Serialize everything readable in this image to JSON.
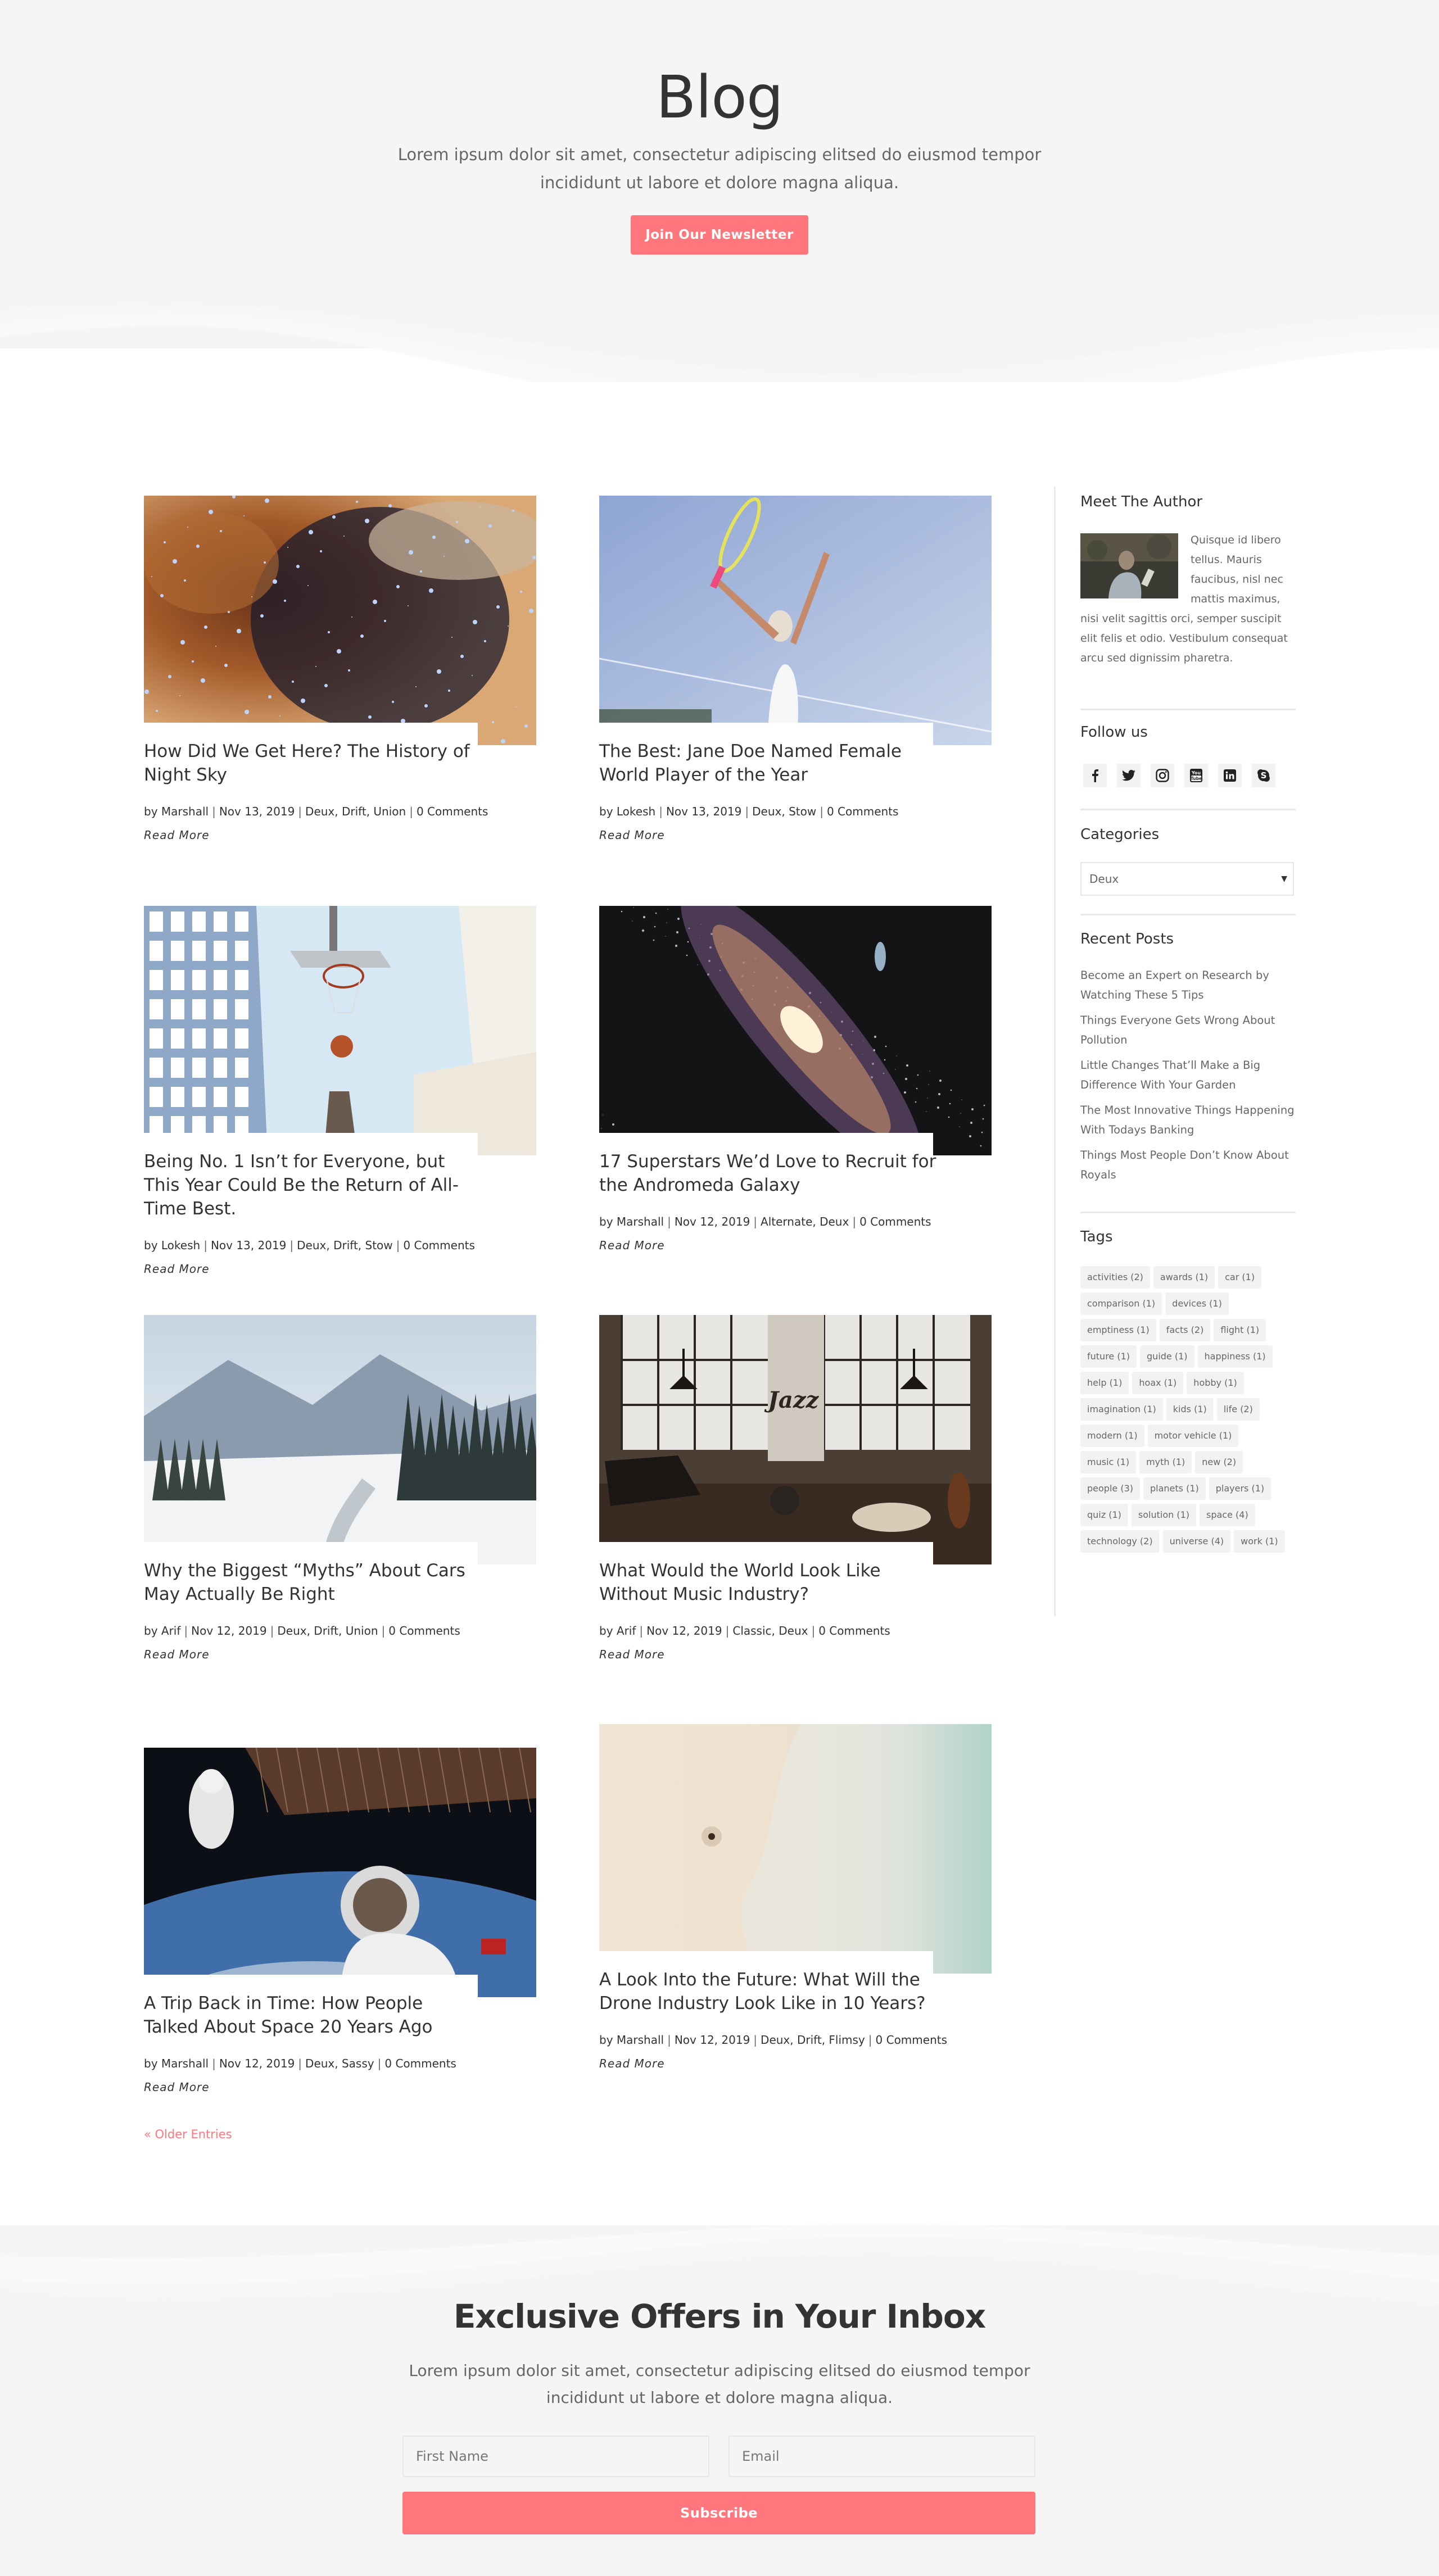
{
  "hero": {
    "title": "Blog",
    "subtitle": "Lorem ipsum dolor sit amet, consectetur adipiscing elitsed do eiusmod tempor incididunt ut labore et dolore magna aliqua.",
    "button_label": "Join Our Newsletter"
  },
  "colors": {
    "accent": "#ff767d",
    "background_gray": "#f5f5f5",
    "text": "#333333",
    "muted": "#666666"
  },
  "posts": [
    {
      "title": "How Did We Get Here? The History of Night Sky",
      "author": "Marshall",
      "date": "Nov 13, 2019",
      "categories": "Deux, Drift, Union",
      "comments": "0 Comments",
      "image": "nebula-stars",
      "read_more": "Read More"
    },
    {
      "title": "The Best: Jane Doe Named Female World Player of the Year",
      "author": "Lokesh",
      "date": "Nov 13, 2019",
      "categories": "Deux, Stow",
      "comments": "0 Comments",
      "image": "tennis-player",
      "read_more": "Read More"
    },
    {
      "title": "Being No. 1 Isn’t for Everyone, but This Year Could Be the Return of All-Time Best.",
      "author": "Lokesh",
      "date": "Nov 13, 2019",
      "categories": "Deux, Drift, Stow",
      "comments": "0 Comments",
      "image": "basketball-buildings",
      "read_more": "Read More"
    },
    {
      "title": "17 Superstars We’d Love to Recruit for the Andromeda Galaxy",
      "author": "Marshall",
      "date": "Nov 12, 2019",
      "categories": "Alternate, Deux",
      "comments": "0 Comments",
      "image": "andromeda-galaxy",
      "read_more": "Read More"
    },
    {
      "title": "Why the Biggest “Myths” About Cars May Actually Be Right",
      "author": "Arif",
      "date": "Nov 12, 2019",
      "categories": "Deux, Drift, Union",
      "comments": "0 Comments",
      "image": "snowy-mountain-road",
      "read_more": "Read More"
    },
    {
      "title": "What Would the World Look Like Without Music Industry?",
      "author": "Arif",
      "date": "Nov 12, 2019",
      "categories": "Classic, Deux",
      "comments": "0 Comments",
      "image": "music-studio",
      "read_more": "Read More"
    },
    {
      "title": "A Trip Back in Time: How People Talked About Space 20 Years Ago",
      "author": "Marshall",
      "date": "Nov 12, 2019",
      "categories": "Deux, Sassy",
      "comments": "0 Comments",
      "image": "astronaut-earth",
      "read_more": "Read More"
    },
    {
      "title": "A Look Into the Future: What Will the Drone Industry Look Like in 10 Years?",
      "author": "Marshall",
      "date": "Nov 12, 2019",
      "categories": "Deux, Drift, Flimsy",
      "comments": "0 Comments",
      "image": "beach-aerial",
      "read_more": "Read More"
    }
  ],
  "meta_prefix": "by",
  "pagination": {
    "older_label": "« Older Entries"
  },
  "sidebar": {
    "author": {
      "title": "Meet The Author",
      "text": "Quisque id libero tellus. Mauris faucibus, nisl nec mattis maximus, nisi velit sagittis orci, semper suscipit elit felis et odio. Vestibulum consequat arcu sed dignissim pharetra."
    },
    "follow": {
      "title": "Follow us",
      "icons": [
        "facebook-icon",
        "twitter-icon",
        "instagram-icon",
        "youtube-icon",
        "linkedin-icon",
        "skype-icon"
      ]
    },
    "categories": {
      "title": "Categories",
      "selected": "Deux"
    },
    "recent": {
      "title": "Recent Posts",
      "items": [
        "Become an Expert on Research by Watching These 5 Tips",
        "Things Everyone Gets Wrong About Pollution",
        "Little Changes That’ll Make a Big Difference With Your Garden",
        "The Most Innovative Things Happening With Todays Banking",
        "Things Most People Don’t Know About Royals"
      ]
    },
    "tags": {
      "title": "Tags",
      "items": [
        "activities (2)",
        "awards (1)",
        "car (1)",
        "comparison (1)",
        "devices (1)",
        "emptiness (1)",
        "facts (2)",
        "flight (1)",
        "future (1)",
        "guide (1)",
        "happiness (1)",
        "help (1)",
        "hoax (1)",
        "hobby (1)",
        "imagination (1)",
        "kids (1)",
        "life (2)",
        "modern (1)",
        "motor vehicle (1)",
        "music (1)",
        "myth (1)",
        "new (2)",
        "people (3)",
        "planets (1)",
        "players (1)",
        "quiz (1)",
        "solution (1)",
        "space (4)",
        "technology (2)",
        "universe (4)",
        "work (1)"
      ]
    }
  },
  "newsletter": {
    "title": "Exclusive Offers in Your Inbox",
    "subtitle": "Lorem ipsum dolor sit amet, consectetur adipiscing elitsed do eiusmod tempor incididunt ut labore et dolore magna aliqua.",
    "first_name_placeholder": "First Name",
    "email_placeholder": "Email",
    "button_label": "Subscribe"
  }
}
